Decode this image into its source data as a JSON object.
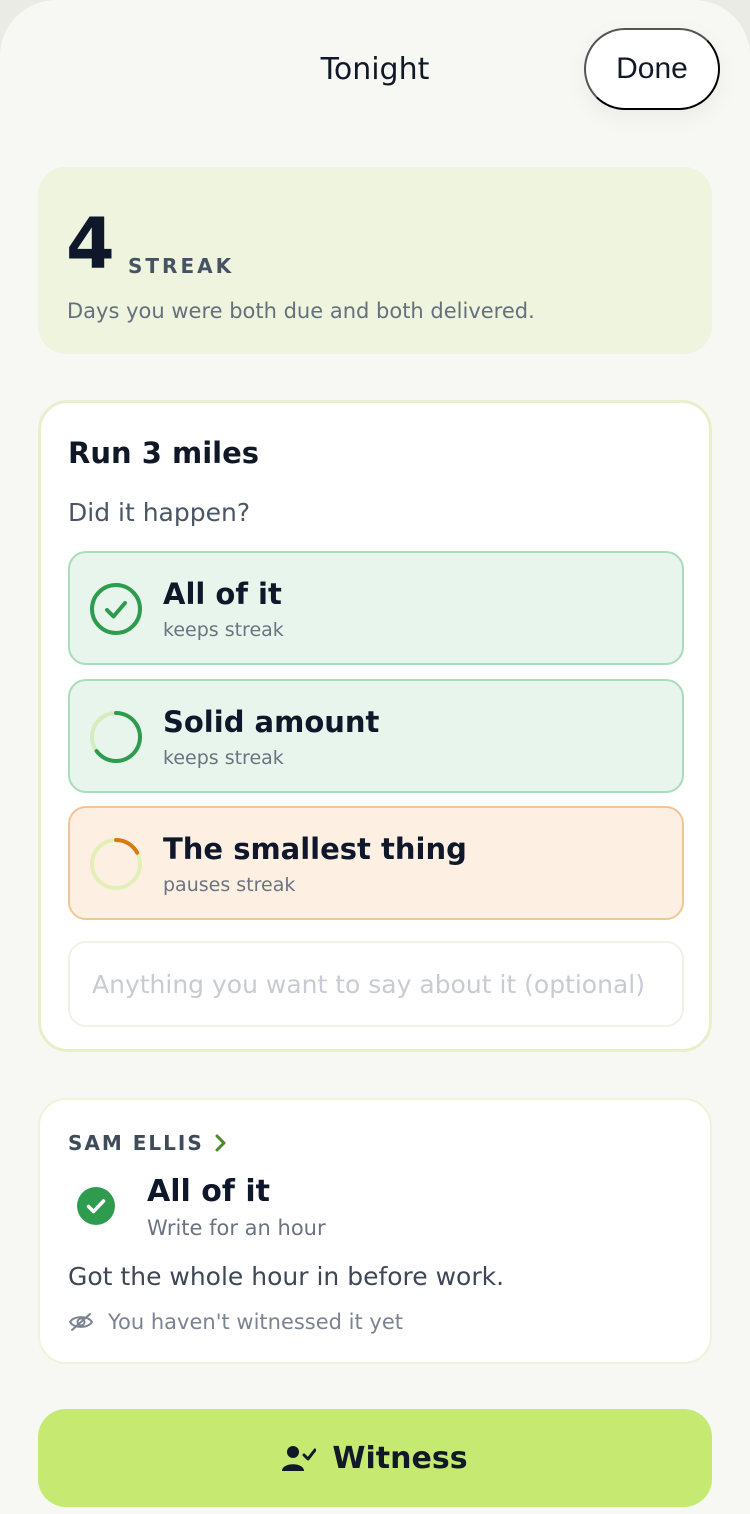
{
  "header": {
    "title": "Tonight",
    "done_label": "Done"
  },
  "streak": {
    "count": "4",
    "label": "STREAK",
    "description": "Days you were both due and both delivered."
  },
  "goal": {
    "title": "Run 3 miles",
    "question": "Did it happen?",
    "options": [
      {
        "title": "All of it",
        "subtitle": "keeps streak",
        "icon": "check-circle-icon"
      },
      {
        "title": "Solid amount",
        "subtitle": "keeps streak",
        "icon": "progress-ring-icon"
      },
      {
        "title": "The smallest thing",
        "subtitle": "pauses streak",
        "icon": "partial-ring-icon"
      }
    ],
    "note_placeholder": "Anything you want to say about it (optional)"
  },
  "partner": {
    "name": "SAM ELLIS",
    "status": "All of it",
    "goal": "Write for an hour",
    "note": "Got the whole hour in before work.",
    "witness_status": "You haven't witnessed it yet"
  },
  "action": {
    "witness_label": "Witness"
  },
  "colors": {
    "accent": "#c6e971",
    "success": "#2e9b4e",
    "warning": "#d97a12"
  }
}
